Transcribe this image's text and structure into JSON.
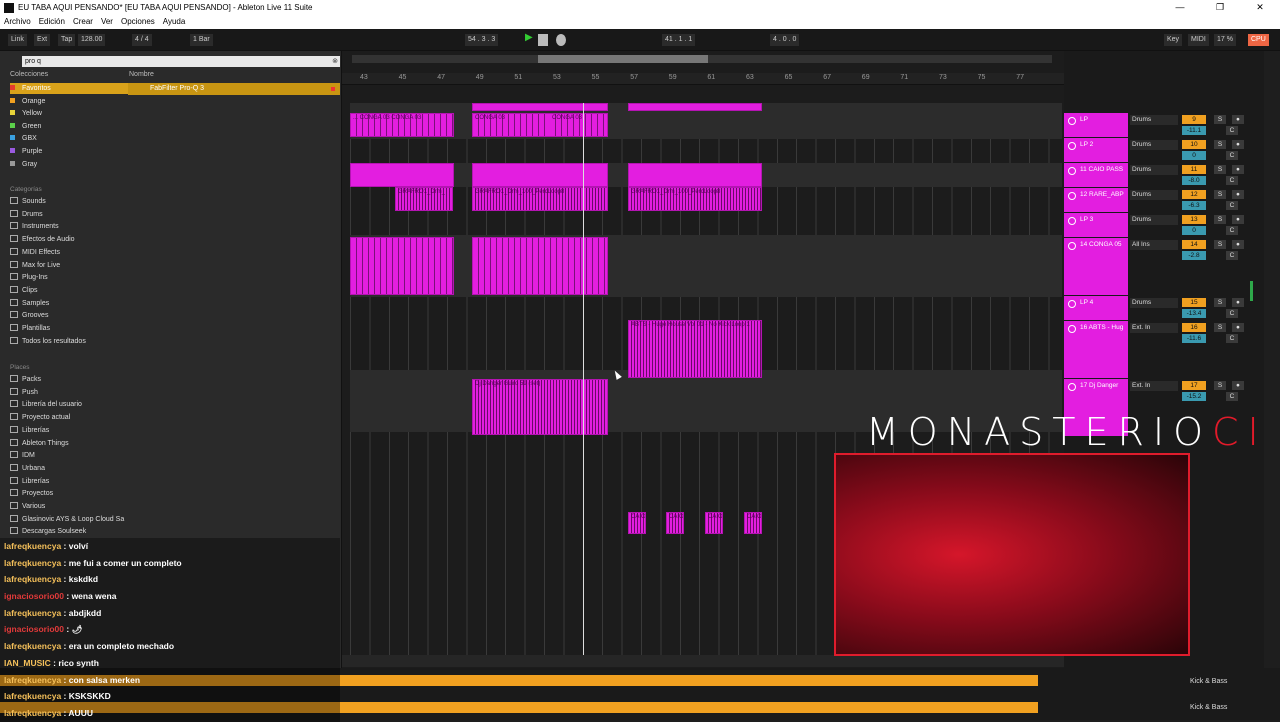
{
  "window": {
    "title": "EU TABA AQUI PENSANDO*  [EU TABA AQUI PENSANDO] - Ableton Live 11 Suite"
  },
  "menu": [
    "Archivo",
    "Edición",
    "Crear",
    "Ver",
    "Opciones",
    "Ayuda"
  ],
  "toolbar": {
    "link": "Link",
    "ext": "Ext",
    "tap": "Tap",
    "tempo": "128.00",
    "meter": "4 / 4",
    "quant": "1 Bar",
    "position": "54 .  3 .  3",
    "loop_start": "41 .  1 .  1",
    "loop_len": "4 .  0 .  0",
    "key": "Key",
    "midi": "MIDI",
    "cpu": "17 %"
  },
  "browser": {
    "search_value": "pro q",
    "collections_header": "Colecciones",
    "name_header": "Nombre",
    "collections": [
      {
        "label": "Favoritos",
        "color": "#e63b2e"
      },
      {
        "label": "Orange",
        "color": "#f0a020"
      },
      {
        "label": "Yellow",
        "color": "#e8d43a"
      },
      {
        "label": "Green",
        "color": "#5bd04a"
      },
      {
        "label": "GBX",
        "color": "#3aa0e0"
      },
      {
        "label": "Purple",
        "color": "#9a5ae0"
      },
      {
        "label": "Gray",
        "color": "#999999"
      }
    ],
    "categories_header": "Categorías",
    "categories": [
      "Sounds",
      "Drums",
      "Instruments",
      "Efectos de Audio",
      "MIDI Effects",
      "Max for Live",
      "Plug-Ins",
      "Clips",
      "Samples",
      "Grooves",
      "Plantillas",
      "Todos los resultados"
    ],
    "places_header": "Places",
    "places": [
      "Packs",
      "Push",
      "Librería del usuario",
      "Proyecto actual",
      "Librerías",
      "Ableton Things",
      "IDM",
      "Urbana",
      "Librerías",
      "Proyectos",
      "Various",
      "Glasinovic AYS & Loop Cloud Sa",
      "Descargas Soulseek"
    ],
    "result": "FabFilter Pro-Q 3"
  },
  "ruler": [
    "43",
    "45",
    "47",
    "49",
    "51",
    "53",
    "55",
    "57",
    "59",
    "61",
    "63",
    "65",
    "67",
    "69",
    "71",
    "73",
    "75",
    "77"
  ],
  "clips": {
    "conga1": "... CONGA 03  CONGA 03",
    "conga2": "CONGA 03",
    "conga3": "CONGA 03",
    "grafro1": "GRAFRO1_Drm_",
    "grafro2": "GRAFRO1_Drm_100_PercLoop8",
    "grafro3": "GRAFRO1_Drm_100_PercLoop8",
    "abts": "ABTS - Huge House Vol 01 - No Kick Loop 1",
    "guiro": "Dj Danger Guiro 59 (set)",
    "caio": "CAIO"
  },
  "tracks": [
    {
      "name": "LP",
      "io": "Drums",
      "num": "9",
      "vol": "-11.1"
    },
    {
      "name": "LP 2",
      "io": "Drums",
      "num": "10",
      "vol": "0"
    },
    {
      "name": "11 CAIO PASS",
      "io": "Drums",
      "num": "11",
      "vol": "-8.0"
    },
    {
      "name": "12 RARE_ABP",
      "io": "Drums",
      "num": "12",
      "vol": "-6.3"
    },
    {
      "name": "LP 3",
      "io": "Drums",
      "num": "13",
      "vol": "0"
    },
    {
      "name": "14 CONGA 05",
      "io": "All Ins",
      "num": "14",
      "vol": "-2.8"
    },
    {
      "name": "LP 4",
      "io": "Drums",
      "num": "15",
      "vol": "-13.4"
    },
    {
      "name": "16 ABTS - Hug",
      "io": "Ext. In",
      "num": "16",
      "vol": "-11.6"
    },
    {
      "name": "17 Dj Danger",
      "io": "Ext. In",
      "num": "17",
      "vol": "-15.2"
    }
  ],
  "chat": [
    {
      "user": "lafreqkuencya",
      "msg": "volví",
      "red": false
    },
    {
      "user": "lafreqkuencya",
      "msg": "me fui a comer un completo",
      "red": false
    },
    {
      "user": "lafreqkuencya",
      "msg": "kskdkd",
      "red": false
    },
    {
      "user": "ignaciosorio00",
      "msg": "wena wena",
      "red": true
    },
    {
      "user": "lafreqkuencya",
      "msg": "abdjkdd",
      "red": false
    },
    {
      "user": "ignaciosorio00",
      "msg": "🌶",
      "red": true
    },
    {
      "user": "lafreqkuencya",
      "msg": "era un completo mechado",
      "red": false
    },
    {
      "user": "IAN_MUSIC",
      "msg": "rico synth",
      "red": false
    },
    {
      "user": "lafreqkuencya",
      "msg": "con salsa merken",
      "red": false
    },
    {
      "user": "lafreqkuencya",
      "msg": "KSKSKKD",
      "red": false
    },
    {
      "user": "lafreqkuencya",
      "msg": "AUUU",
      "red": false
    }
  ],
  "overlay": {
    "brand_main": "MONASTERIO",
    "brand_accent": "CI"
  },
  "bottom": {
    "device": "Kick & Bass"
  }
}
